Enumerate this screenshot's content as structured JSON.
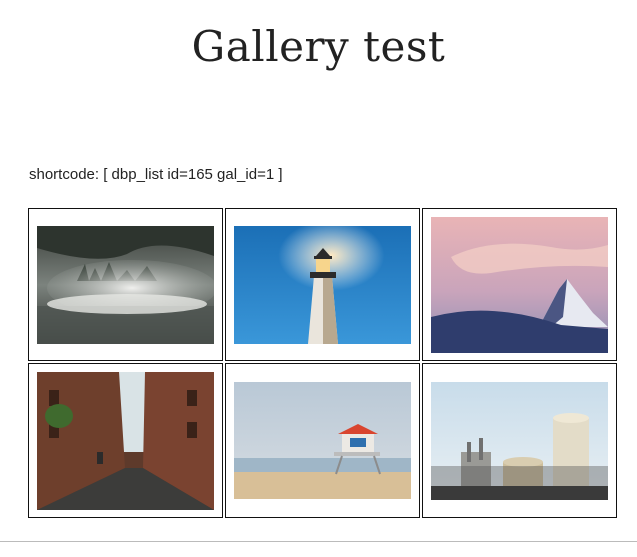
{
  "page": {
    "title": "Gallery test",
    "shortcode": "shortcode: [ dbp_list id=165 gal_id=1 ]"
  },
  "gallery": {
    "items": [
      {
        "subject": "misty forest over lake",
        "icon": "forest-fog-image"
      },
      {
        "subject": "lighthouse at night",
        "icon": "lighthouse-image"
      },
      {
        "subject": "snowy mountain peak at dusk",
        "icon": "mountain-image"
      },
      {
        "subject": "brick alley",
        "icon": "alley-image"
      },
      {
        "subject": "lifeguard tower on beach",
        "icon": "lifeguard-tower-image"
      },
      {
        "subject": "industrial silos",
        "icon": "factory-image"
      }
    ]
  }
}
